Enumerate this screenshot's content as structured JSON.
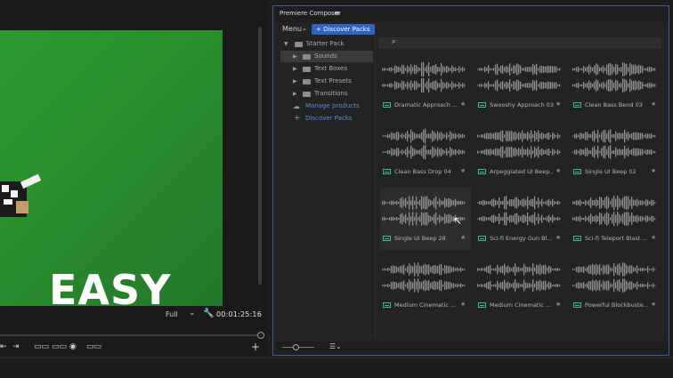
{
  "monitor": {
    "overlay_text": "EASY",
    "resolution": "Full",
    "resolution_caret": "⌄",
    "timecode": "00:01:25:16",
    "transport": [
      "⇤",
      "▫▫",
      "⇥",
      "▭▭",
      "▭▭",
      "◉",
      "▭▭"
    ],
    "add": "+"
  },
  "composer": {
    "title": "Premiere Composer",
    "menu_icon": "≡",
    "menu_label": "Menu",
    "menu_caret": "⌄",
    "discover_label": "+ Discover Packs",
    "tree": {
      "root": "Starter Pack",
      "folders": [
        "Sounds",
        "Text Boxes",
        "Text Presets",
        "Transitions"
      ],
      "manage": "Manage products",
      "discover": "Discover Packs"
    },
    "sounds": [
      {
        "label": "Dramatic Approach ..."
      },
      {
        "label": "Swooshy Approach 03"
      },
      {
        "label": "Clean Bass Bend 03"
      },
      {
        "label": "Clean Bass Drop 04"
      },
      {
        "label": "Arpeggiated UI Beep..."
      },
      {
        "label": "Single UI Beep 02"
      },
      {
        "label": "Single UI Beep 28"
      },
      {
        "label": "Sci-fi Energy Gun Bl..."
      },
      {
        "label": "Sci-fi Teleport Blast ..."
      },
      {
        "label": "Medium Cinematic ..."
      },
      {
        "label": "Medium Cinematic ..."
      },
      {
        "label": "Powerful Blockbuste..."
      }
    ],
    "colors": {
      "accent": "#2f64c7",
      "link": "#5b8be0",
      "wave": "#8f8f8f",
      "sound_icon": "#2ec28d"
    }
  }
}
